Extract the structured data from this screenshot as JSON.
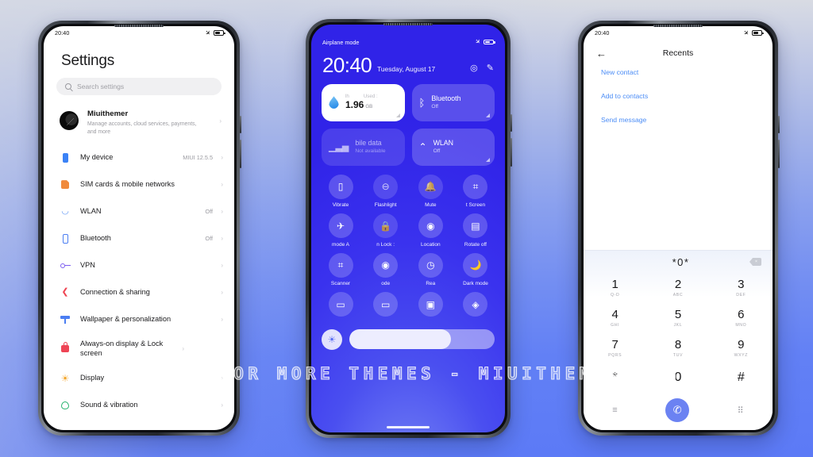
{
  "watermark": "VISIT FOR MORE THEMES - MIUITHEMER.COM",
  "colors": {
    "accent_blue": "#4c8df6",
    "cc_blue": "#3a32ee",
    "call_green_blue": "#6b82f2",
    "link_blue": "#4c8df6"
  },
  "settings_phone": {
    "status": {
      "time": "20:40",
      "plane_icon": "airplane-icon",
      "battery_icon": "battery-icon"
    },
    "title": "Settings",
    "search": {
      "placeholder": "Search settings",
      "icon": "search-icon"
    },
    "account": {
      "name": "Miuithemer",
      "description": "Manage accounts, cloud services, payments, and more",
      "chevron": "›"
    },
    "items": [
      {
        "label": "My device",
        "value": "MIUI 12.5.5",
        "icon": "device-icon",
        "color": "#3b82f6"
      },
      {
        "label": "SIM cards & mobile networks",
        "value": "",
        "icon": "sim-card-icon",
        "color": "#f08a3c"
      },
      {
        "label": "WLAN",
        "value": "Off",
        "icon": "wifi-icon",
        "color": "#6b9ef5"
      },
      {
        "label": "Bluetooth",
        "value": "Off",
        "icon": "bluetooth-icon",
        "color": "#4b7ef2"
      },
      {
        "label": "VPN",
        "value": "",
        "icon": "vpn-key-icon",
        "color": "#7b5cf0"
      },
      {
        "label": "Connection & sharing",
        "value": "",
        "icon": "share-icon",
        "color": "#ef4452"
      },
      {
        "label": "Wallpaper & personalization",
        "value": "",
        "icon": "wallpaper-icon",
        "color": "#4b7ef2"
      },
      {
        "label": "Always-on display & Lock screen",
        "value": "",
        "icon": "lock-icon",
        "color": "#ee4455"
      },
      {
        "label": "Display",
        "value": "",
        "icon": "brightness-icon",
        "color": "#f3a62c"
      },
      {
        "label": "Sound & vibration",
        "value": "",
        "icon": "sound-icon",
        "color": "#2fb673"
      }
    ],
    "chevron": "›"
  },
  "control_center_phone": {
    "status": {
      "label": "Airplane mode",
      "plane_icon": "airplane-icon",
      "battery_icon": "battery-icon"
    },
    "clock": {
      "time": "20:40",
      "date": "Tuesday, August 17"
    },
    "header_actions": [
      {
        "name": "settings-gear-icon",
        "glyph": "◎"
      },
      {
        "name": "edit-icon",
        "glyph": "✎"
      }
    ],
    "big_tiles": [
      {
        "name": "data-usage-tile",
        "style": "light",
        "top_left": "lh",
        "top_right": "Used :",
        "value": "1.96",
        "unit": "GB",
        "icon": "water-drop-icon"
      },
      {
        "name": "bluetooth-tile",
        "style": "on",
        "title": "Bluetooth",
        "subtitle": "Off",
        "icon": "bluetooth-icon"
      },
      {
        "name": "mobile-data-tile",
        "style": "dim",
        "title": "bile data",
        "subtitle": "Not available",
        "icon": "signal-bars-icon"
      },
      {
        "name": "wlan-tile",
        "style": "on",
        "title": "WLAN",
        "subtitle": "Off",
        "icon": "wifi-icon"
      }
    ],
    "toggles": [
      [
        {
          "label": "Vibrate",
          "icon": "vibrate-icon",
          "glyph": "▯",
          "state": "on"
        },
        {
          "label": "Flashlight",
          "icon": "flashlight-icon",
          "glyph": "⊖",
          "state": "dim"
        },
        {
          "label": "Mute",
          "icon": "bell-icon",
          "glyph": "🔔",
          "state": "dim"
        },
        {
          "label": "t  Screen",
          "icon": "screenshot-icon",
          "glyph": "⌗",
          "state": "on"
        }
      ],
      [
        {
          "label": "mode    A",
          "icon": "airplane-icon",
          "glyph": "✈",
          "state": "on"
        },
        {
          "label": "n    Lock :",
          "icon": "lock-icon",
          "glyph": "🔒",
          "state": "dim"
        },
        {
          "label": "Location",
          "icon": "location-pin-icon",
          "glyph": "◉",
          "state": "on"
        },
        {
          "label": "Rotate off",
          "icon": "rotate-lock-icon",
          "glyph": "▤",
          "state": "on"
        }
      ],
      [
        {
          "label": "Scanner",
          "icon": "qr-scanner-icon",
          "glyph": "⌗",
          "state": "on"
        },
        {
          "label": "ode",
          "icon": "eye-icon",
          "glyph": "◉",
          "state": "on"
        },
        {
          "label": "Rea",
          "icon": "reading-mode-icon",
          "glyph": "◷",
          "state": "on"
        },
        {
          "label": "Dark mode",
          "icon": "moon-icon",
          "glyph": "🌙",
          "state": "on"
        }
      ],
      [
        {
          "label": "",
          "icon": "battery-saver-icon",
          "glyph": "▭",
          "state": "on"
        },
        {
          "label": "",
          "icon": "ultra-battery-icon",
          "glyph": "▭",
          "state": "on"
        },
        {
          "label": "",
          "icon": "cast-screen-icon",
          "glyph": "▣",
          "state": "on"
        },
        {
          "label": "",
          "icon": "theme-icon",
          "glyph": "◈",
          "state": "on"
        }
      ]
    ],
    "brightness": {
      "icon": "brightness-icon",
      "percent": 70
    },
    "home_indicator": "home-indicator"
  },
  "dialer_phone": {
    "status": {
      "time": "20:40",
      "plane_icon": "airplane-icon",
      "battery_icon": "battery-icon"
    },
    "header": {
      "back_icon": "back-arrow-icon",
      "title": "Recents"
    },
    "links": [
      "New contact",
      "Add to contacts",
      "Send message"
    ],
    "display": {
      "number": "*0*",
      "backspace_icon": "backspace-icon"
    },
    "keys": [
      {
        "digit": "1",
        "sub": "Q-D"
      },
      {
        "digit": "2",
        "sub": "ABC"
      },
      {
        "digit": "3",
        "sub": "DEF"
      },
      {
        "digit": "4",
        "sub": "GHI"
      },
      {
        "digit": "5",
        "sub": "JKL"
      },
      {
        "digit": "6",
        "sub": "MNO"
      },
      {
        "digit": "7",
        "sub": "PQRS"
      },
      {
        "digit": "8",
        "sub": "TUV"
      },
      {
        "digit": "9",
        "sub": "WXYZ"
      },
      {
        "digit": "*",
        "sub": ""
      },
      {
        "digit": "0",
        "sub": ""
      },
      {
        "digit": "#",
        "sub": ""
      }
    ],
    "bottom": [
      {
        "name": "menu-icon",
        "glyph": "≡"
      },
      {
        "name": "call-button",
        "glyph": "✆"
      },
      {
        "name": "keypad-icon",
        "glyph": "⠿"
      }
    ]
  }
}
